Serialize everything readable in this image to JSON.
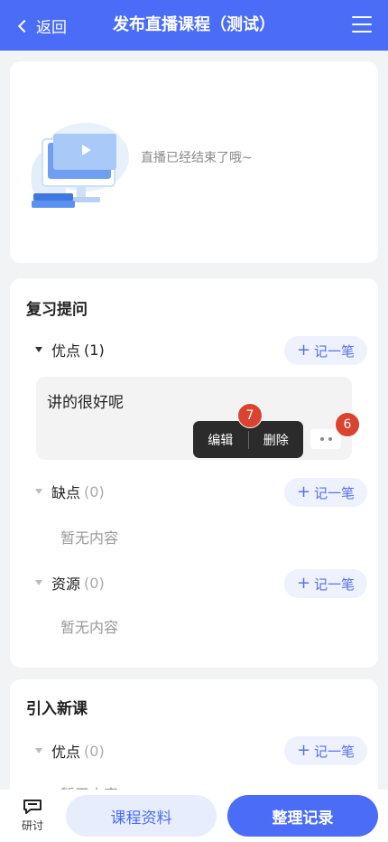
{
  "header": {
    "back_label": "返回",
    "title": "发布直播课程（测试）"
  },
  "live": {
    "message": "直播已经结束了哦~"
  },
  "review": {
    "title": "复习提问",
    "groups": [
      {
        "name": "优点",
        "count": "(1)",
        "note_label": "记一笔"
      },
      {
        "name": "缺点",
        "count": "(0)",
        "note_label": "记一笔",
        "empty": "暂无内容"
      },
      {
        "name": "资源",
        "count": "(0)",
        "note_label": "记一笔",
        "empty": "暂无内容"
      }
    ],
    "comment": {
      "text": "讲的很好呢"
    },
    "popover": {
      "edit": "编辑",
      "delete": "删除"
    },
    "badges": {
      "more": "6",
      "edit_menu": "7"
    }
  },
  "new_course": {
    "title": "引入新课",
    "groups": [
      {
        "name": "优点",
        "count": "(0)",
        "note_label": "记一笔",
        "empty": "暂无内容"
      }
    ]
  },
  "footer": {
    "discuss_label": "研讨",
    "materials_label": "课程资料",
    "organize_label": "整理记录"
  },
  "colors": {
    "primary": "#4a6cf7",
    "badge": "#d9432f"
  },
  "icons": {
    "back": "chevron-left-icon",
    "menu": "hamburger-icon",
    "plus": "plus-icon",
    "discuss": "chat-icon",
    "more": "more-dots-icon"
  }
}
